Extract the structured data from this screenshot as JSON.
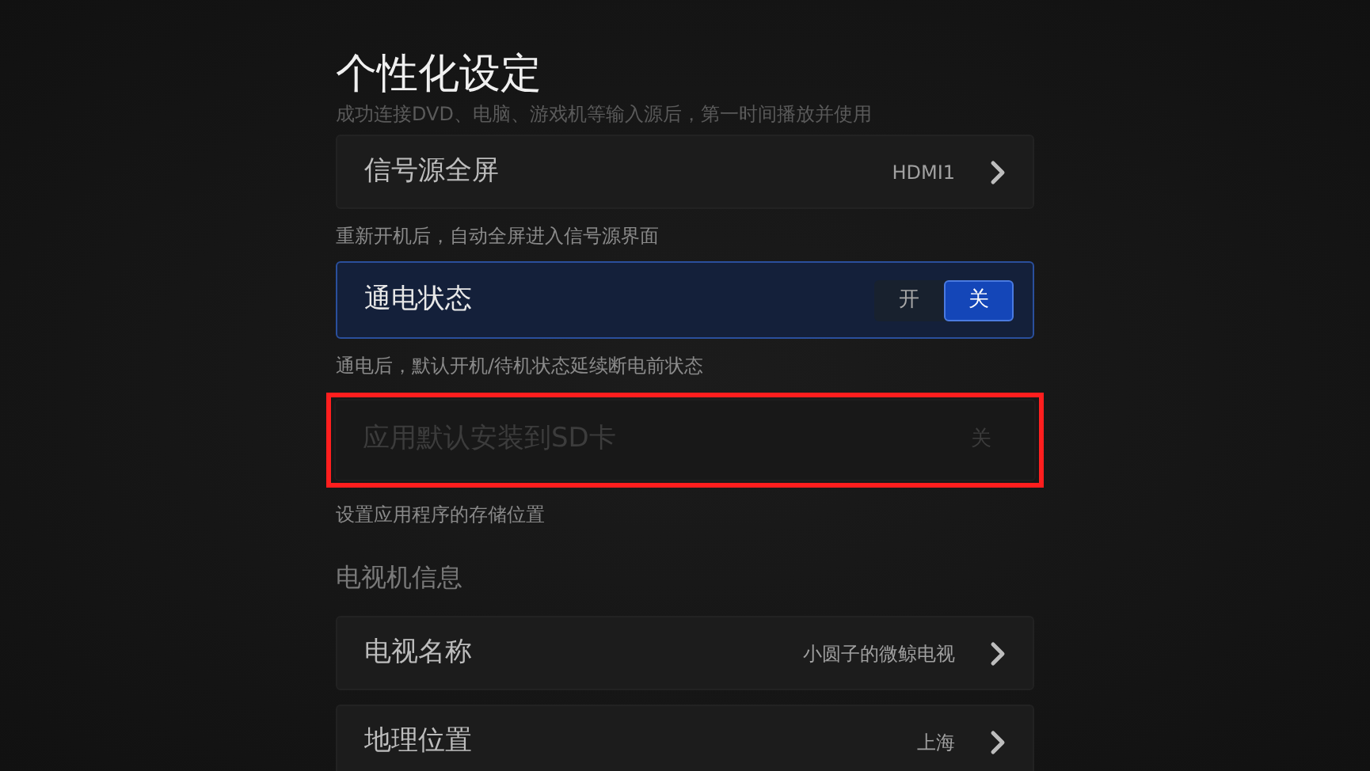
{
  "title": "个性化设定",
  "items": [
    {
      "kind": "hint",
      "text": "成功连接DVD、电脑、游戏机等输入源后，第一时间播放并使用",
      "faded": true
    },
    {
      "kind": "link",
      "label": "信号源全屏",
      "value": "HDMI1",
      "focused": false
    },
    {
      "kind": "hint",
      "text": "重新开机后，自动全屏进入信号源界面",
      "faded": false
    },
    {
      "kind": "toggle",
      "label": "通电状态",
      "focused": true,
      "options": [
        {
          "label": "开",
          "selected": false
        },
        {
          "label": "关",
          "selected": true
        }
      ]
    },
    {
      "kind": "hint",
      "text": "通电后，默认开机/待机状态延续断电前状态",
      "faded": false
    },
    {
      "kind": "value",
      "label": "应用默认安装到SD卡",
      "value": "关",
      "disabled": true,
      "highlighted": true
    },
    {
      "kind": "hint",
      "text": "设置应用程序的存储位置",
      "faded": false
    },
    {
      "kind": "section",
      "text": "电视机信息"
    },
    {
      "kind": "link",
      "label": "电视名称",
      "value": "小圆子的微鲸电视",
      "focused": false
    },
    {
      "kind": "link",
      "label": "地理位置",
      "value": "上海",
      "focused": false
    }
  ]
}
